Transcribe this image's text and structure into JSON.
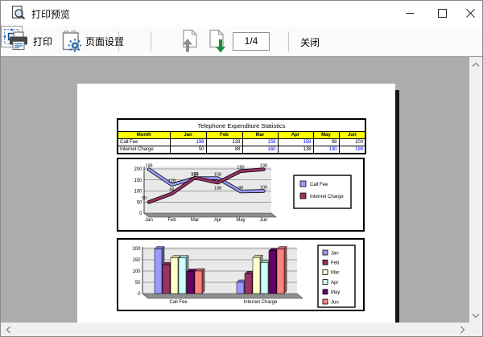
{
  "window": {
    "title": "打印预览"
  },
  "icons": {
    "titlebar": "print-preview-icon",
    "print": "printer-icon",
    "page_setup": "page-gear-icon",
    "fit": "fit-to-window-icon",
    "page_up": "page-up-icon",
    "page_down": "page-down-icon"
  },
  "toolbar": {
    "print_label": "打印",
    "page_setup_label": "页面设置",
    "page_indicator": "1/4",
    "close_label": "关闭"
  },
  "table": {
    "title": "Telephone Expenditure Statistics",
    "header_bg": "#FFFF00",
    "highlight_threshold": 150,
    "highlight_color": "#0000FF",
    "columns": [
      "Month",
      "Jan",
      "Feb",
      "Mar",
      "Apr",
      "May",
      "Jun"
    ],
    "rows": [
      {
        "label": "Call Fee",
        "values": [
          198,
          128,
          158,
          158,
          98,
          100
        ]
      },
      {
        "label": "Internet Charge",
        "values": [
          50,
          88,
          160,
          138,
          190,
          198
        ]
      }
    ]
  },
  "chart_data": [
    {
      "type": "line",
      "title": "",
      "categories": [
        "Jan",
        "Feb",
        "Mar",
        "Apr",
        "May",
        "Jun"
      ],
      "series": [
        {
          "name": "Call Fee",
          "color": "#9999FF",
          "values": [
            198,
            128,
            158,
            158,
            98,
            100
          ]
        },
        {
          "name": "Internet Charge",
          "color": "#993366",
          "values": [
            50,
            88,
            160,
            138,
            190,
            198
          ]
        }
      ],
      "xlabel": "",
      "ylabel": "",
      "ylim": [
        0,
        200
      ],
      "yticks": [
        0,
        50,
        100,
        150,
        200
      ],
      "grid": true,
      "data_labels": true,
      "legend_position": "right",
      "plot_bg": "#E9E9E9"
    },
    {
      "type": "bar",
      "title": "",
      "categories": [
        "Call Fee",
        "Internet Charge"
      ],
      "series": [
        {
          "name": "Jan",
          "color": "#9999FF",
          "values": [
            198,
            50
          ]
        },
        {
          "name": "Feb",
          "color": "#993366",
          "values": [
            128,
            88
          ]
        },
        {
          "name": "Mar",
          "color": "#FFFFCC",
          "values": [
            158,
            160
          ]
        },
        {
          "name": "Apr",
          "color": "#CCFFFF",
          "values": [
            158,
            138
          ]
        },
        {
          "name": "May",
          "color": "#660066",
          "values": [
            98,
            190
          ]
        },
        {
          "name": "Jun",
          "color": "#FF8080",
          "values": [
            100,
            198
          ]
        }
      ],
      "xlabel": "",
      "ylabel": "",
      "ylim": [
        0,
        200
      ],
      "yticks": [
        0,
        50,
        100,
        150,
        200
      ],
      "grid": true,
      "data_labels": false,
      "legend_position": "right",
      "plot_bg": "#E9E9E9"
    }
  ]
}
